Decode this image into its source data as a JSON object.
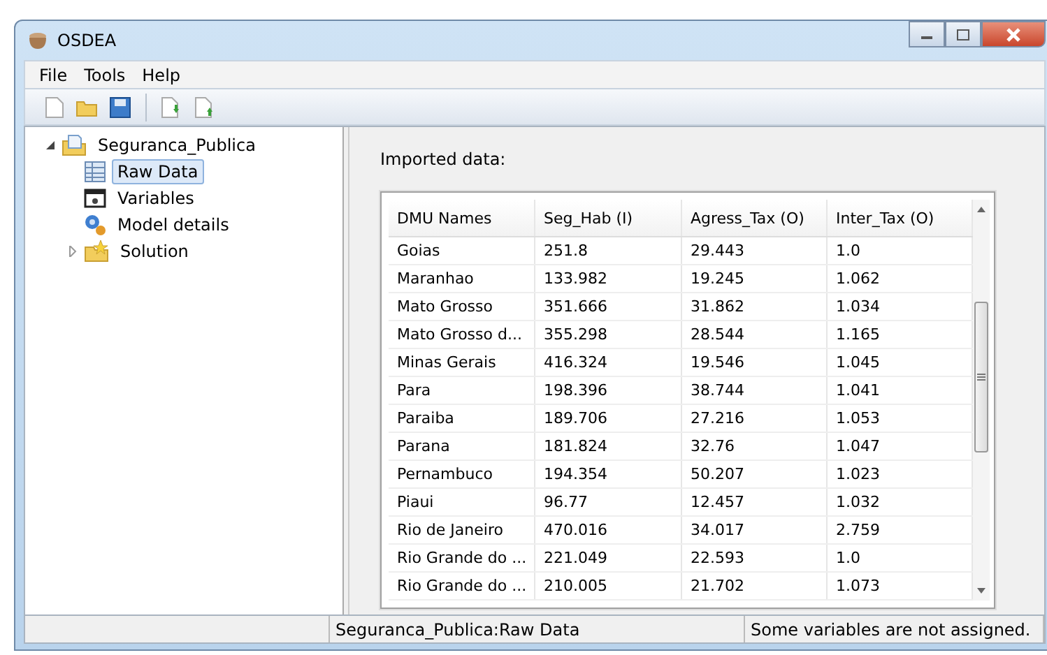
{
  "window": {
    "title": "OSDEA"
  },
  "menu": [
    "File",
    "Tools",
    "Help"
  ],
  "tree": [
    {
      "label": "Seguranca_Publica",
      "kind": "project",
      "expanded": true,
      "selected": false,
      "children": [
        {
          "label": "Raw Data",
          "kind": "table",
          "selected": true
        },
        {
          "label": "Variables",
          "kind": "variables",
          "selected": false
        },
        {
          "label": "Model details",
          "kind": "gears",
          "selected": false
        },
        {
          "label": "Solution",
          "kind": "solution",
          "expanded": false,
          "selected": false
        }
      ]
    }
  ],
  "panel": {
    "heading": "Imported data:"
  },
  "table": {
    "columns": [
      "DMU Names",
      "Seg_Hab (I)",
      "Agress_Tax (O)",
      "Inter_Tax (O)"
    ],
    "rows": [
      [
        "Goias",
        "251.8",
        "29.443",
        "1.0"
      ],
      [
        "Maranhao",
        "133.982",
        "19.245",
        "1.062"
      ],
      [
        "Mato Grosso",
        "351.666",
        "31.862",
        "1.034"
      ],
      [
        "Mato Grosso d...",
        "355.298",
        "28.544",
        "1.165"
      ],
      [
        "Minas Gerais",
        "416.324",
        "19.546",
        "1.045"
      ],
      [
        "Para",
        "198.396",
        "38.744",
        "1.041"
      ],
      [
        "Paraiba",
        "189.706",
        "27.216",
        "1.053"
      ],
      [
        "Parana",
        "181.824",
        "32.76",
        "1.047"
      ],
      [
        "Pernambuco",
        "194.354",
        "50.207",
        "1.023"
      ],
      [
        "Piaui",
        "96.77",
        "12.457",
        "1.032"
      ],
      [
        "Rio de Janeiro",
        "470.016",
        "34.017",
        "2.759"
      ],
      [
        "Rio Grande do ...",
        "221.049",
        "22.593",
        "1.0"
      ],
      [
        "Rio Grande do ...",
        "210.005",
        "21.702",
        "1.073"
      ]
    ]
  },
  "status_bar": [
    "Seguranca_Publica:Raw Data",
    "Some variables are not assigned."
  ]
}
